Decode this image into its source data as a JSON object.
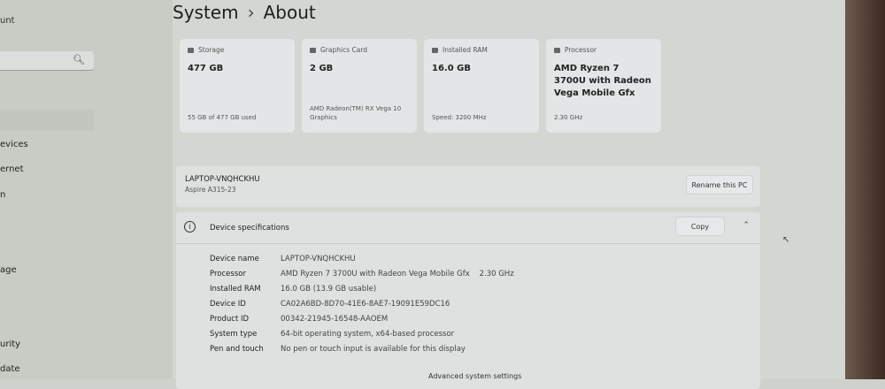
{
  "sidebar": {
    "account": "unt",
    "search_icon": "search-icon",
    "items": [
      "evices",
      "ernet",
      "n",
      "age",
      "urity",
      "date"
    ]
  },
  "header": {
    "section": "System",
    "separator": "›",
    "page": "About"
  },
  "cards": [
    {
      "label": "Storage",
      "value": "477 GB",
      "sub": "55 GB of 477 GB used",
      "icon": "storage-icon"
    },
    {
      "label": "Graphics Card",
      "value": "2 GB",
      "sub": "AMD Radeon(TM) RX Vega 10 Graphics",
      "icon": "graphics-card-icon"
    },
    {
      "label": "Installed RAM",
      "value": "16.0 GB",
      "sub": "Speed: 3200 MHz",
      "icon": "ram-icon"
    },
    {
      "label": "Processor",
      "value": "AMD Ryzen 7 3700U with Radeon Vega Mobile Gfx",
      "sub": "2.30 GHz",
      "icon": "processor-icon"
    }
  ],
  "pc": {
    "name": "LAPTOP-VNQHCKHU",
    "model": "Aspire A315-23",
    "rename_label": "Rename this PC"
  },
  "specs": {
    "title": "Device specifications",
    "copy_label": "Copy",
    "rows": [
      {
        "k": "Device name",
        "v": "LAPTOP-VNQHCKHU"
      },
      {
        "k": "Processor",
        "v": "AMD Ryzen 7 3700U with Radeon Vega Mobile Gfx    2.30 GHz"
      },
      {
        "k": "Installed RAM",
        "v": "16.0 GB (13.9 GB usable)"
      },
      {
        "k": "Device ID",
        "v": "CA02A6BD-8D70-41E6-8AE7-19091E59DC16"
      },
      {
        "k": "Product ID",
        "v": "00342-21945-16548-AAOEM"
      },
      {
        "k": "System type",
        "v": "64-bit operating system, x64-based processor"
      },
      {
        "k": "Pen and touch",
        "v": "No pen or touch input is available for this display"
      }
    ],
    "advanced": "Advanced system settings"
  }
}
